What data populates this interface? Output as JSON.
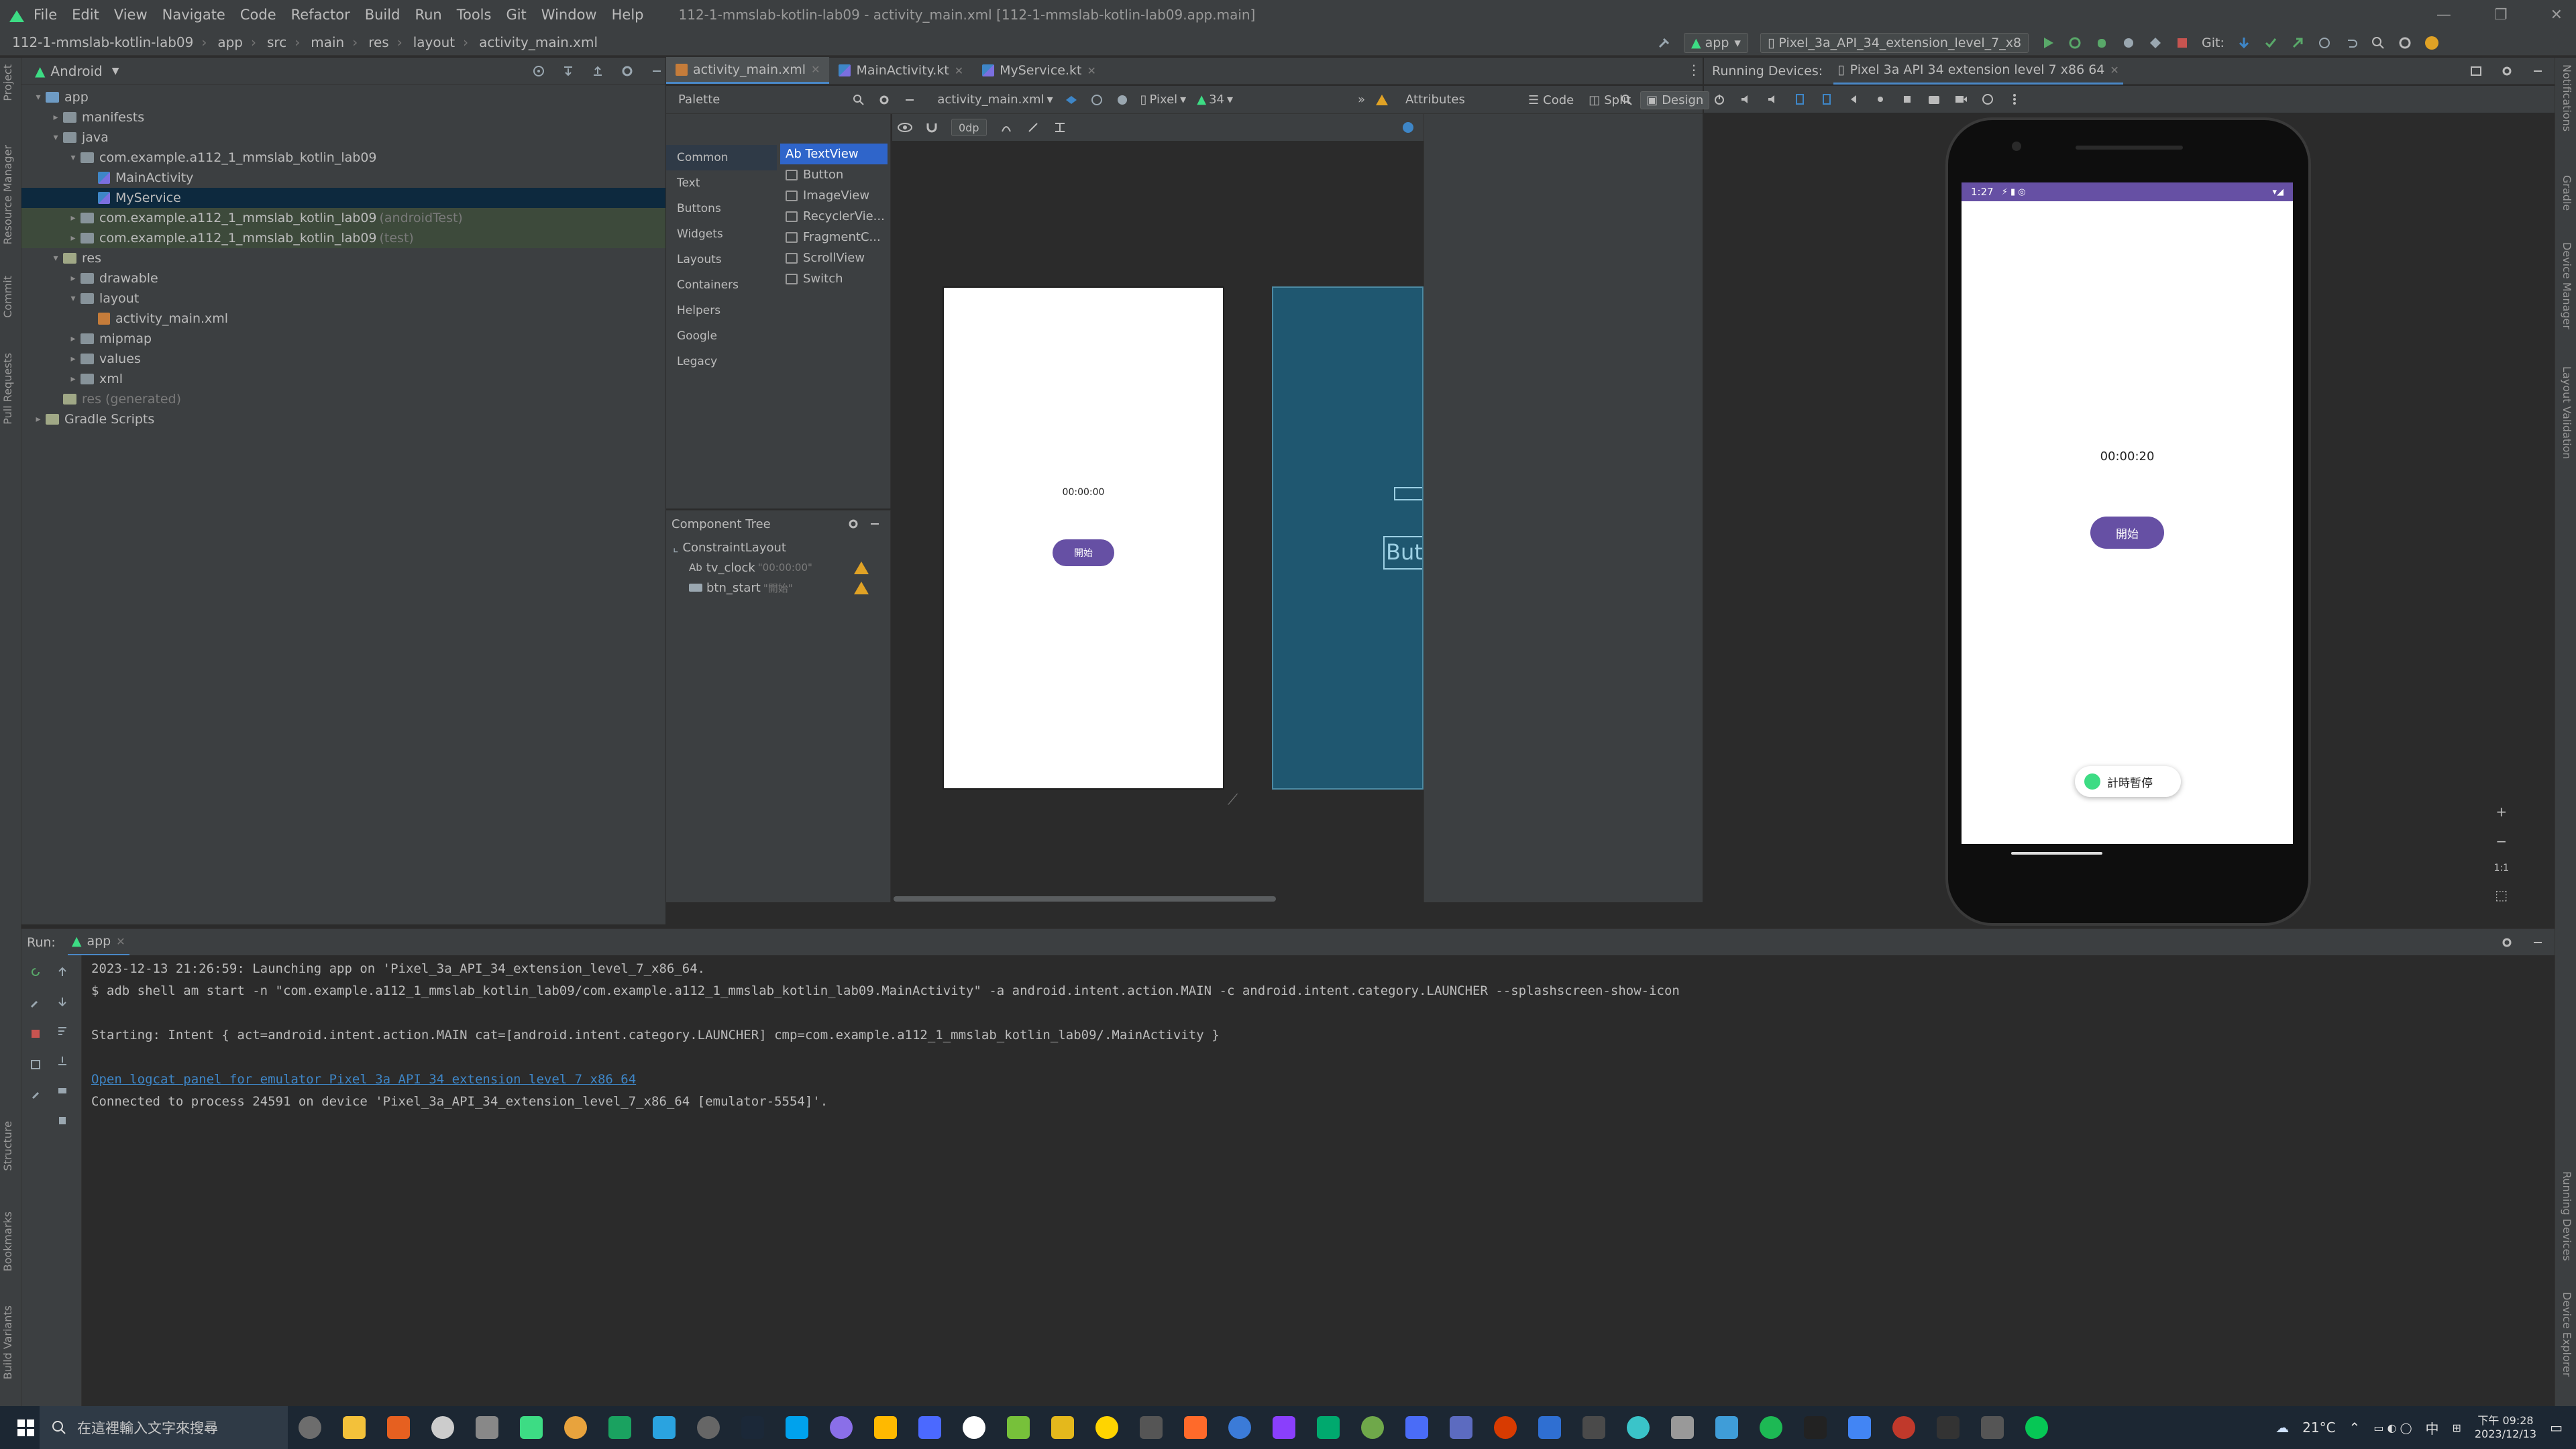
{
  "titlebar": {
    "menus": [
      "File",
      "Edit",
      "View",
      "Navigate",
      "Code",
      "Refactor",
      "Build",
      "Run",
      "Tools",
      "Git",
      "Window",
      "Help"
    ],
    "title": "112-1-mmslab-kotlin-lab09 - activity_main.xml [112-1-mmslab-kotlin-lab09.app.main]"
  },
  "breadcrumb": [
    "112-1-mmslab-kotlin-lab09",
    "app",
    "src",
    "main",
    "res",
    "layout",
    "activity_main.xml"
  ],
  "toolbar": {
    "run_config": "app",
    "device": "Pixel_3a_API_34_extension_level_7_x8",
    "git_label": "Git:"
  },
  "project": {
    "view_mode": "Android",
    "rows": [
      {
        "label": "app",
        "depth": 0,
        "arrow": "▾",
        "kind": "folder-blue"
      },
      {
        "label": "manifests",
        "depth": 1,
        "arrow": "▸",
        "kind": "folder"
      },
      {
        "label": "java",
        "depth": 1,
        "arrow": "▾",
        "kind": "folder"
      },
      {
        "label": "com.example.a112_1_mmslab_kotlin_lab09",
        "depth": 2,
        "arrow": "▾",
        "kind": "folder"
      },
      {
        "label": "MainActivity",
        "depth": 3,
        "arrow": "",
        "kind": "kotlin"
      },
      {
        "label": "MyService",
        "depth": 3,
        "arrow": "",
        "kind": "kotlin",
        "selected": true
      },
      {
        "label": "com.example.a112_1_mmslab_kotlin_lab09",
        "suffix": "(androidTest)",
        "depth": 2,
        "arrow": "▸",
        "kind": "folder",
        "tint": true
      },
      {
        "label": "com.example.a112_1_mmslab_kotlin_lab09",
        "suffix": "(test)",
        "depth": 2,
        "arrow": "▸",
        "kind": "folder",
        "tint": true
      },
      {
        "label": "res",
        "depth": 1,
        "arrow": "▾",
        "kind": "folder-res"
      },
      {
        "label": "drawable",
        "depth": 2,
        "arrow": "▸",
        "kind": "folder"
      },
      {
        "label": "layout",
        "depth": 2,
        "arrow": "▾",
        "kind": "folder"
      },
      {
        "label": "activity_main.xml",
        "depth": 3,
        "arrow": "",
        "kind": "xml"
      },
      {
        "label": "mipmap",
        "depth": 2,
        "arrow": "▸",
        "kind": "folder"
      },
      {
        "label": "values",
        "depth": 2,
        "arrow": "▸",
        "kind": "folder"
      },
      {
        "label": "xml",
        "depth": 2,
        "arrow": "▸",
        "kind": "folder"
      },
      {
        "label": "res (generated)",
        "depth": 1,
        "arrow": "",
        "kind": "folder-res",
        "dim": true
      },
      {
        "label": "Gradle Scripts",
        "depth": 0,
        "arrow": "▸",
        "kind": "gradle"
      }
    ]
  },
  "left_strip": [
    "Project",
    "Resource Manager",
    "Commit",
    "Pull Requests",
    "Structure",
    "Bookmarks",
    "Build Variants"
  ],
  "right_strip": [
    "Notifications",
    "Gradle",
    "Device Manager",
    "Layout Validation",
    "Running Devices",
    "Device Explorer"
  ],
  "editor_tabs": [
    {
      "label": "activity_main.xml",
      "active": true
    },
    {
      "label": "MainActivity.kt",
      "active": false
    },
    {
      "label": "MyService.kt",
      "active": false
    }
  ],
  "view_modes": {
    "code": "Code",
    "split": "Split",
    "design": "Design"
  },
  "palette": {
    "title": "Palette",
    "categories": [
      "Common",
      "Text",
      "Buttons",
      "Widgets",
      "Layouts",
      "Containers",
      "Helpers",
      "Google",
      "Legacy"
    ],
    "items": [
      "Ab TextView",
      "Button",
      "ImageView",
      "RecyclerVie...",
      "FragmentC...",
      "ScrollView",
      "Switch"
    ]
  },
  "design_toolbar": {
    "file": "activity_main.xml",
    "device": "Pixel",
    "api": "34",
    "margin": "0dp"
  },
  "component_tree": {
    "title": "Component Tree",
    "root": "ConstraintLayout",
    "children": [
      {
        "label": "tv_clock",
        "hint": "\"00:00:00\""
      },
      {
        "label": "btn_start",
        "hint": "\"開始\""
      }
    ]
  },
  "attributes": {
    "title": "Attributes"
  },
  "design_preview": {
    "clock": "00:00:00",
    "button": "開始",
    "blueprint_button": "Butt"
  },
  "running_devices": {
    "label": "Running Devices:",
    "tab": "Pixel 3a API 34 extension level 7 x86 64",
    "status_time": "1:27",
    "clock": "00:00:20",
    "button": "開始",
    "toast": "計時暫停",
    "zoom_ratio": "1:1"
  },
  "run": {
    "label": "Run:",
    "tab": "app",
    "lines": [
      {
        "text": "2023-12-13 21:26:59: Launching app on 'Pixel_3a_API_34_extension_level_7_x86_64.",
        "link": false
      },
      {
        "text": "$ adb shell am start -n \"com.example.a112_1_mmslab_kotlin_lab09/com.example.a112_1_mmslab_kotlin_lab09.MainActivity\" -a android.intent.action.MAIN -c android.intent.category.LAUNCHER --splashscreen-show-icon",
        "link": false
      },
      {
        "text": "",
        "link": false
      },
      {
        "text": "Starting: Intent { act=android.intent.action.MAIN cat=[android.intent.category.LAUNCHER] cmp=com.example.a112_1_mmslab_kotlin_lab09/.MainActivity }",
        "link": false
      },
      {
        "text": "",
        "link": false
      },
      {
        "text": "Open logcat panel for emulator Pixel 3a API 34 extension level 7 x86 64",
        "link": true
      },
      {
        "text": "Connected to process 24591 on device 'Pixel_3a_API_34_extension_level_7_x86_64 [emulator-5554]'.",
        "link": false
      }
    ]
  },
  "taskbar": {
    "search_placeholder": "在這裡輸入文字來搜尋",
    "weather": "21°C",
    "ime": "中",
    "time": "下午 09:28",
    "date": "2023/12/13"
  }
}
